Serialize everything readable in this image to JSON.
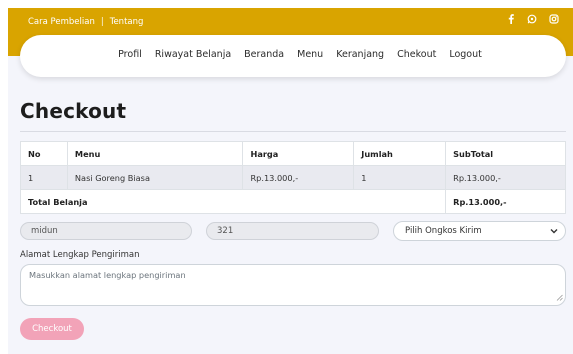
{
  "topbar": {
    "links": [
      "Cara Pembelian",
      "Tentang"
    ],
    "separator": "|",
    "social_icons": [
      "facebook-icon",
      "whatsapp-icon",
      "instagram-icon"
    ],
    "color": "#d9a400"
  },
  "navbar": {
    "items": [
      "Profil",
      "Riwayat Belanja",
      "Beranda",
      "Menu",
      "Keranjang",
      "Chekout",
      "Logout"
    ]
  },
  "page": {
    "title": "Checkout"
  },
  "table": {
    "headers": [
      "No",
      "Menu",
      "Harga",
      "Jumlah",
      "SubTotal"
    ],
    "rows": [
      [
        "1",
        "Nasi Goreng Biasa",
        "Rp.13.000,-",
        "1",
        "Rp.13.000,-"
      ]
    ],
    "total_label": "Total Belanja",
    "total_value": "Rp.13.000,-"
  },
  "form": {
    "name_value": "midun",
    "phone_value": "321",
    "shipping_select": "Pilih Ongkos Kirim",
    "address_label": "Alamat Lengkap Pengiriman",
    "address_placeholder": "Masukkan alamat lengkap pengiriman",
    "submit_label": "Checkout",
    "submit_color": "#f2a3b8"
  }
}
